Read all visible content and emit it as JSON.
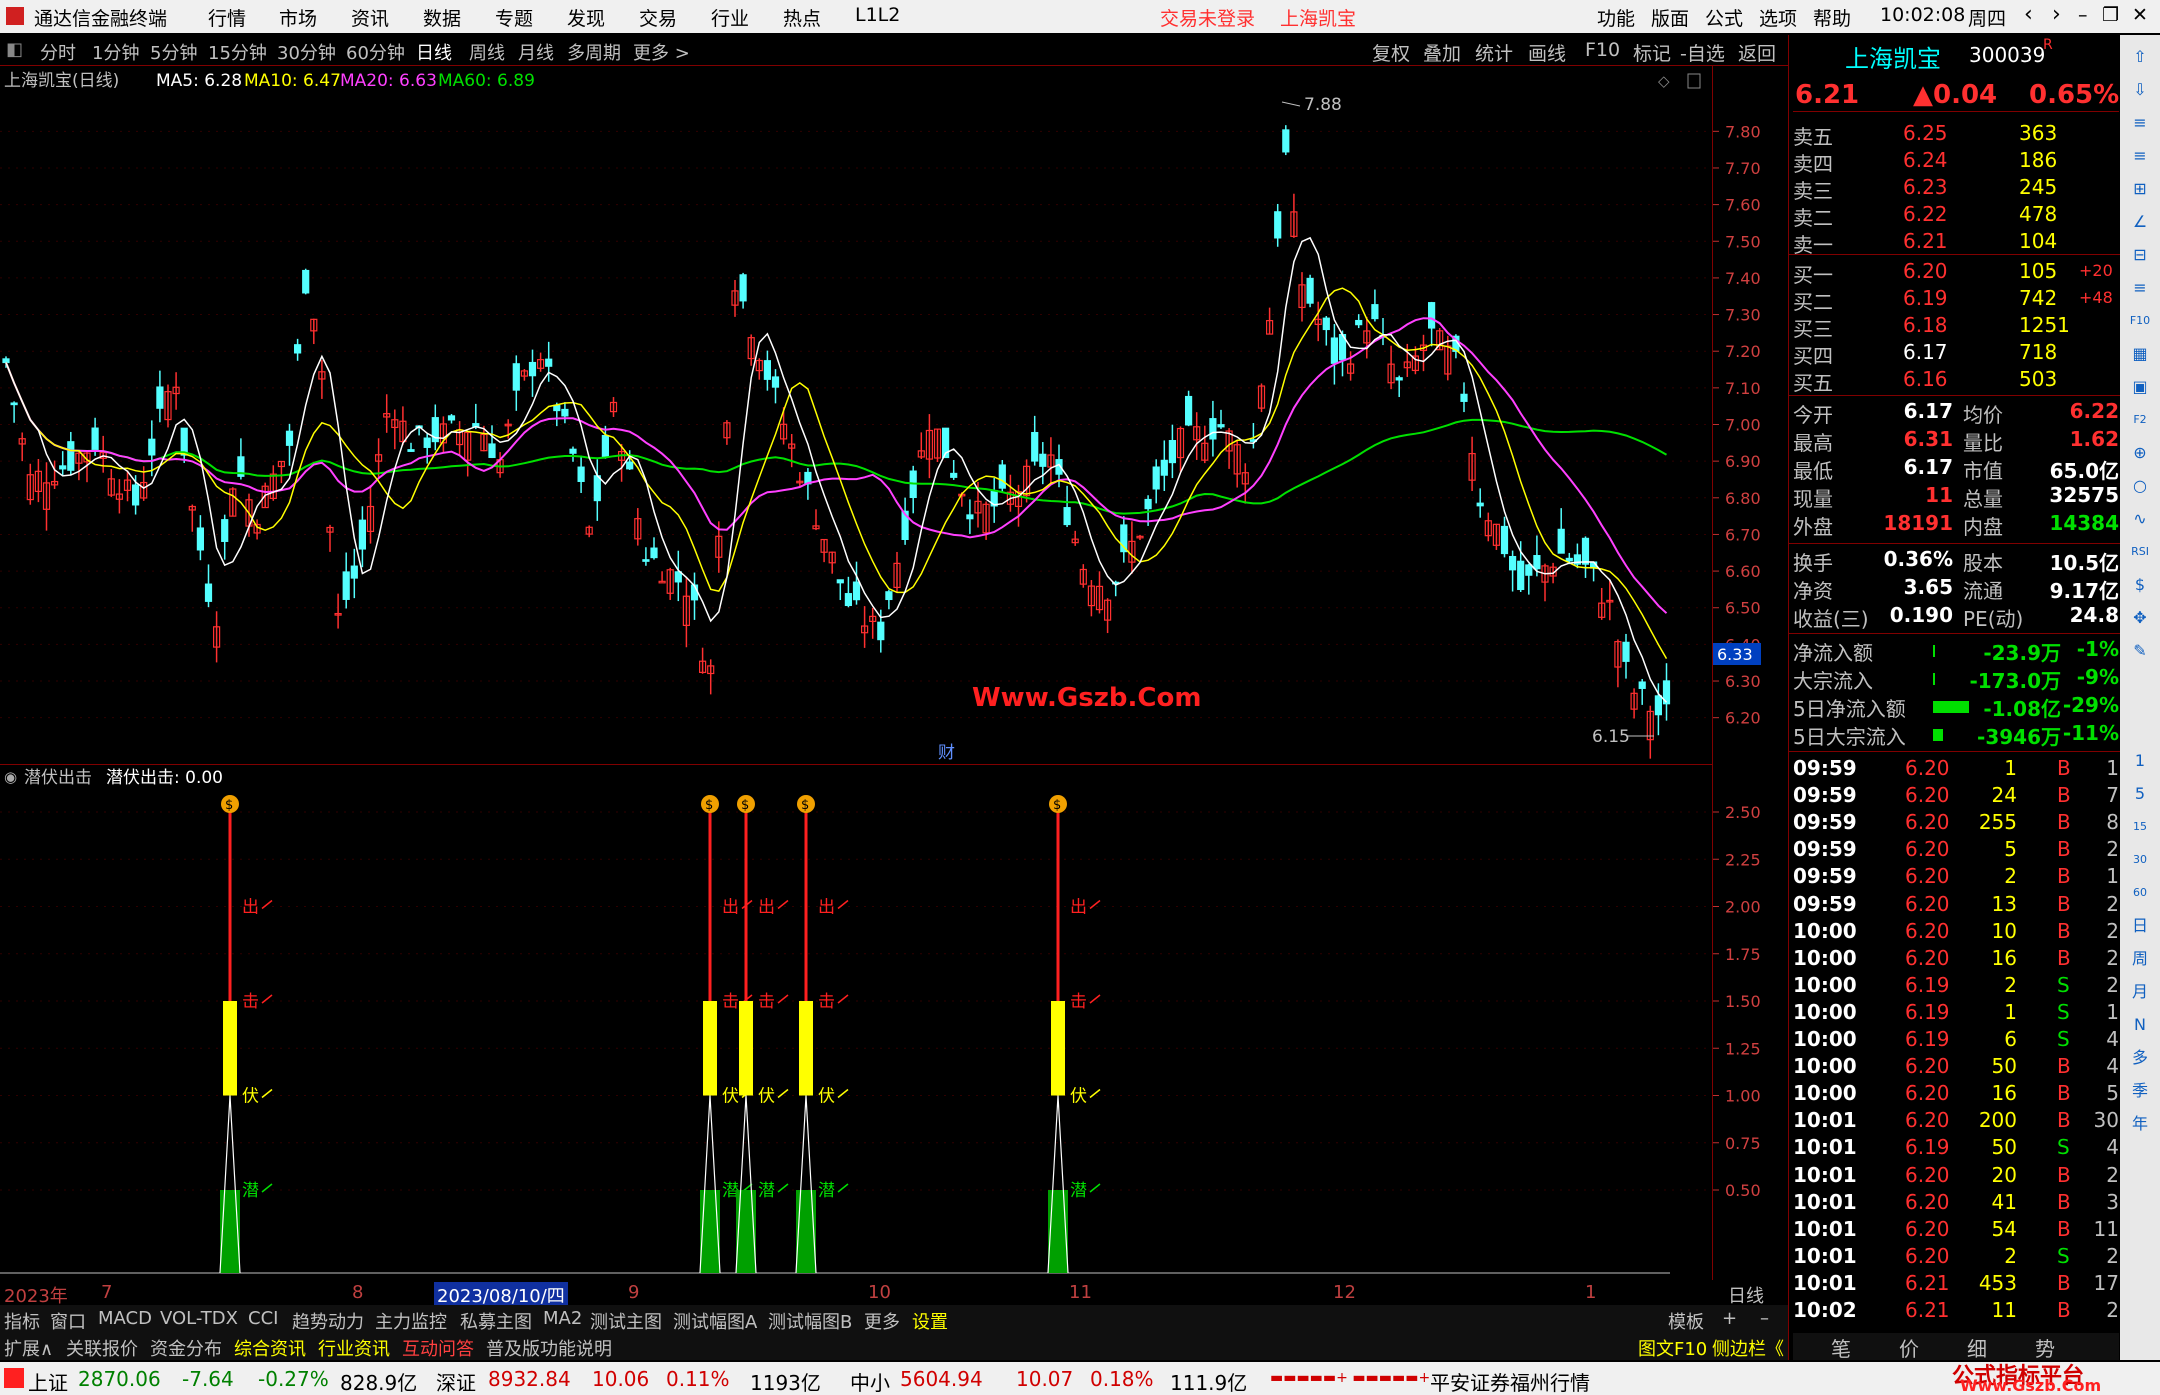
{
  "titlebar": {
    "app_title": "通达信金融终端",
    "menu": [
      "行情",
      "市场",
      "资讯",
      "数据",
      "专题",
      "发现",
      "交易",
      "行业",
      "热点",
      "L1L2"
    ],
    "login": "交易未登录",
    "stock": "上海凯宝",
    "right_menu": [
      "功能",
      "版面",
      "公式",
      "选项",
      "帮助"
    ],
    "time": "10:02:08",
    "weekday": "周四"
  },
  "periods": [
    "分时",
    "1分钟",
    "5分钟",
    "15分钟",
    "30分钟",
    "60分钟",
    "日线",
    "周线",
    "月线",
    "多周期",
    "更多 >"
  ],
  "active_period": "日线",
  "toolbar_right": [
    "复权",
    "叠加",
    "统计",
    "画线",
    "F10",
    "标记",
    "-自选",
    "返回"
  ],
  "main_chart": {
    "header_name": "上海凯宝(日线)",
    "ma5": "MA5: 6.28",
    "ma10": "MA10: 6.47",
    "ma20": "MA20: 6.63",
    "ma60": "MA60: 6.89",
    "high_label": "7.88",
    "low_label": "6.15",
    "watermark": "Www.Gszb.Com",
    "cai_marker": "财",
    "price_axis": [
      "7.80",
      "7.70",
      "7.60",
      "7.50",
      "7.40",
      "7.30",
      "7.20",
      "7.10",
      "7.00",
      "6.90",
      "6.80",
      "6.70",
      "6.60",
      "6.50",
      "6.40",
      "6.30",
      "6.20"
    ],
    "current_price_tag": "6.33",
    "colors": {
      "ma5": "#ffffff",
      "ma10": "#ffff00",
      "ma20": "#ff40ff",
      "ma60": "#00e000",
      "up": "#ff3030",
      "down": "#54ffff"
    }
  },
  "sub_chart": {
    "header": "潜伏出击",
    "header_value": "潜伏出击: 0.00",
    "axis": [
      "2.50",
      "2.25",
      "2.00",
      "1.75",
      "1.50",
      "1.25",
      "1.00",
      "0.75",
      "0.50"
    ],
    "labels": [
      "出",
      "击",
      "伏",
      "潜"
    ]
  },
  "date_axis": [
    "2023年",
    "7",
    "8",
    "2023/08/10/四",
    "9",
    "10",
    "11",
    "12",
    "1"
  ],
  "date_axis_right": "日线",
  "indicator_tabs": [
    "指标",
    "窗口",
    "MACD",
    "VOL-TDX",
    "CCI",
    "趋势动力",
    "主力监控",
    "私募主图",
    "MA2",
    "测试主图",
    "测试幅图A",
    "测试幅图B",
    "更多",
    "设置"
  ],
  "template_btn": "模板",
  "bottom_tabs": [
    "扩展∧",
    "关联报价",
    "资金分布",
    "综合资讯",
    "行业资讯",
    "互动问答",
    "普及版功能说明"
  ],
  "bottom_right_tabs": [
    "图文F10",
    "侧边栏《"
  ],
  "side_tabs_bottom": [
    "笔",
    "价",
    "细",
    "势"
  ],
  "quote": {
    "name": "上海凯宝",
    "code": "300039",
    "suffix": "R",
    "price": "6.21",
    "change": "▲0.04",
    "pct": "0.65%",
    "asks": [
      {
        "label": "卖五",
        "price": "6.25",
        "vol": "363"
      },
      {
        "label": "卖四",
        "price": "6.24",
        "vol": "186"
      },
      {
        "label": "卖三",
        "price": "6.23",
        "vol": "245"
      },
      {
        "label": "卖二",
        "price": "6.22",
        "vol": "478"
      },
      {
        "label": "卖一",
        "price": "6.21",
        "vol": "104"
      }
    ],
    "bids": [
      {
        "label": "买一",
        "price": "6.20",
        "vol": "105",
        "chg": "+20"
      },
      {
        "label": "买二",
        "price": "6.19",
        "vol": "742",
        "chg": "+48"
      },
      {
        "label": "买三",
        "price": "6.18",
        "vol": "1251",
        "chg": ""
      },
      {
        "label": "买四",
        "price": "6.17",
        "vol": "718",
        "chg": ""
      },
      {
        "label": "买五",
        "price": "6.16",
        "vol": "503",
        "chg": ""
      }
    ],
    "stats": [
      {
        "l1": "今开",
        "v1": "6.17",
        "l2": "均价",
        "v2": "6.22"
      },
      {
        "l1": "最高",
        "v1": "6.31",
        "l2": "量比",
        "v2": "1.62"
      },
      {
        "l1": "最低",
        "v1": "6.17",
        "l2": "市值",
        "v2": "65.0亿"
      },
      {
        "l1": "现量",
        "v1": "11",
        "l2": "总量",
        "v2": "32575"
      },
      {
        "l1": "外盘",
        "v1": "18191",
        "l2": "内盘",
        "v2": "14384"
      }
    ],
    "stats2": [
      {
        "l1": "换手",
        "v1": "0.36%",
        "l2": "股本",
        "v2": "10.5亿"
      },
      {
        "l1": "净资",
        "v1": "3.65",
        "l2": "流通",
        "v2": "9.17亿"
      },
      {
        "l1": "收益(三)",
        "v1": "0.190",
        "l2": "PE(动)",
        "v2": "24.8"
      }
    ],
    "flows": [
      {
        "label": "净流入额",
        "value": "-23.9万",
        "pct": "-1%"
      },
      {
        "label": "大宗流入",
        "value": "-173.0万",
        "pct": "-9%"
      },
      {
        "label": "5日净流入额",
        "value": "-1.08亿",
        "pct": "-29%"
      },
      {
        "label": "5日大宗流入",
        "value": "-3946万",
        "pct": "-11%"
      }
    ],
    "ticks": [
      [
        "09:59",
        "6.20",
        "1",
        "B",
        "1"
      ],
      [
        "09:59",
        "6.20",
        "24",
        "B",
        "7"
      ],
      [
        "09:59",
        "6.20",
        "255",
        "B",
        "8"
      ],
      [
        "09:59",
        "6.20",
        "5",
        "B",
        "2"
      ],
      [
        "09:59",
        "6.20",
        "2",
        "B",
        "1"
      ],
      [
        "09:59",
        "6.20",
        "13",
        "B",
        "2"
      ],
      [
        "10:00",
        "6.20",
        "10",
        "B",
        "2"
      ],
      [
        "10:00",
        "6.20",
        "16",
        "B",
        "2"
      ],
      [
        "10:00",
        "6.19",
        "2",
        "S",
        "2"
      ],
      [
        "10:00",
        "6.19",
        "1",
        "S",
        "1"
      ],
      [
        "10:00",
        "6.19",
        "6",
        "S",
        "4"
      ],
      [
        "10:00",
        "6.20",
        "50",
        "B",
        "4"
      ],
      [
        "10:00",
        "6.20",
        "16",
        "B",
        "5"
      ],
      [
        "10:01",
        "6.20",
        "200",
        "B",
        "30"
      ],
      [
        "10:01",
        "6.19",
        "50",
        "S",
        "4"
      ],
      [
        "10:01",
        "6.20",
        "20",
        "B",
        "2"
      ],
      [
        "10:01",
        "6.20",
        "41",
        "B",
        "3"
      ],
      [
        "10:01",
        "6.20",
        "54",
        "B",
        "11"
      ],
      [
        "10:01",
        "6.20",
        "2",
        "S",
        "2"
      ],
      [
        "10:01",
        "6.21",
        "453",
        "B",
        "17"
      ],
      [
        "10:02",
        "6.21",
        "11",
        "B",
        "2"
      ]
    ]
  },
  "side_icons": [
    "⇧",
    "⇩",
    "≡",
    "≡",
    "⊞",
    "∠",
    "⊟",
    "≡",
    "F10",
    "▦",
    "▣",
    "F2",
    "⊕",
    "○",
    "∿",
    "RSI",
    "$",
    "✥",
    "✎",
    "1",
    "5",
    "15",
    "30",
    "60",
    "日",
    "周",
    "月",
    "N",
    "多",
    "季",
    "年"
  ],
  "statusbar": {
    "sh_label": "上证",
    "sh_val": "2870.06",
    "sh_chg": "-7.64",
    "sh_pct": "-0.27%",
    "sh_amt": "828.9亿",
    "sz_label": "深证",
    "sz_val": "8932.84",
    "sz_chg": "10.06",
    "sz_pct": "0.11%",
    "sz_amt": "1193亿",
    "zx_label": "中小",
    "zx_val": "5604.94",
    "zx_chg": "10.07",
    "zx_pct": "0.18%",
    "zx_amt": "111.9亿",
    "broker": "平安证券福州行情",
    "watermark": "公式指标平台",
    "watermark_url": "Www.Gszb.Com"
  }
}
